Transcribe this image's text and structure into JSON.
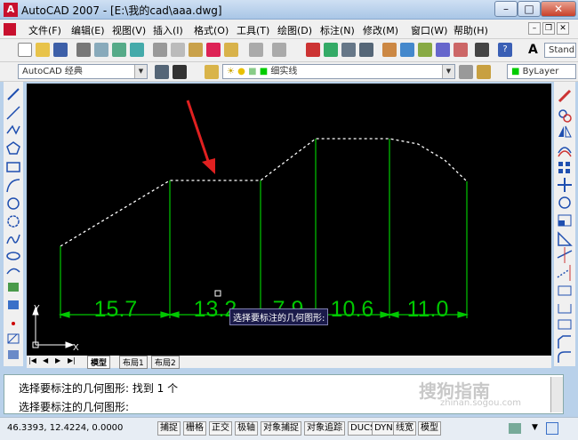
{
  "window": {
    "title": "AutoCAD 2007 - [E:\\我的cad\\aaa.dwg]",
    "app_icon_letter": "A",
    "minimize": "–",
    "maximize": "□",
    "close": "✕"
  },
  "menu": [
    {
      "label": "文件(F)"
    },
    {
      "label": "编辑(E)"
    },
    {
      "label": "视图(V)"
    },
    {
      "label": "插入(I)"
    },
    {
      "label": "格式(O)"
    },
    {
      "label": "工具(T)"
    },
    {
      "label": "绘图(D)"
    },
    {
      "label": "标注(N)"
    },
    {
      "label": "修改(M)"
    },
    {
      "label": "窗口(W)"
    },
    {
      "label": "帮助(H)"
    }
  ],
  "toolbar": {
    "workspace": "AutoCAD 经典",
    "layer": "细实线",
    "linetype_value": "ByLayer",
    "text_style": "Stand"
  },
  "drawing": {
    "dimensions": [
      "15.7",
      "13.2",
      "7.9",
      "10.6",
      "11.0"
    ],
    "tooltip": "选择要标注的几何图形:",
    "ucs_x": "X",
    "ucs_y": "Y"
  },
  "tabs": [
    "模型",
    "布局1",
    "布局2"
  ],
  "command": {
    "line1": "选择要标注的几何图形: 找到 1 个",
    "line2": "选择要标注的几何图形:"
  },
  "watermark": {
    "text": "搜狗指南",
    "url": "zhinan.sogou.com"
  },
  "status": {
    "coords": "46.3393, 12.4224, 0.0000",
    "toggles": [
      "捕捉",
      "栅格",
      "正交",
      "极轴",
      "对象捕捉",
      "对象追踪",
      "DUCS",
      "DYN",
      "线宽",
      "模型"
    ]
  },
  "colors": {
    "canvas": "#000000",
    "geometry": "#00c800",
    "dashed": "#ffffff",
    "arrow": "#e02020"
  }
}
